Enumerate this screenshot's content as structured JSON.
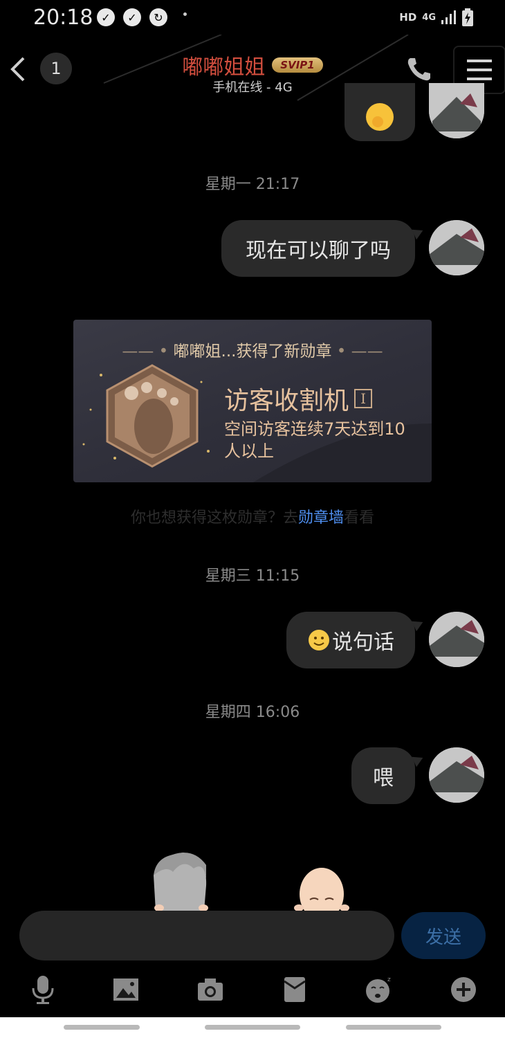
{
  "status_bar": {
    "time": "20:18",
    "network": "HD",
    "cell": "4G"
  },
  "header": {
    "unread_count": "1",
    "contact_name": "嘟嘟姐姐",
    "vip_badge": "SVIP1",
    "online_status": "手机在线 - 4G"
  },
  "messages": {
    "ts1": "星期一 21:17",
    "msg1": "现在可以聊了吗",
    "ts2": "星期三 11:15",
    "msg2": "说句话",
    "ts3": "星期四 16:06",
    "msg3": "喂"
  },
  "medal": {
    "header": "嘟嘟姐...获得了新勋章",
    "title": "访客收割机",
    "level": "I",
    "description": "空间访客连续7天达到10人以上",
    "prompt_before": "你也想获得这枚勋章？去",
    "prompt_link": "勋章墙",
    "prompt_after": "看看"
  },
  "input": {
    "send_label": "发送"
  },
  "colors": {
    "name_red": "#d24e3e",
    "link_blue": "#4f8ff0",
    "send_bg": "#072343",
    "medal_gold": "#e7c29e"
  },
  "icons": [
    "microphone-icon",
    "image-icon",
    "camera-icon",
    "red-packet-icon",
    "emoji-icon",
    "plus-icon"
  ]
}
